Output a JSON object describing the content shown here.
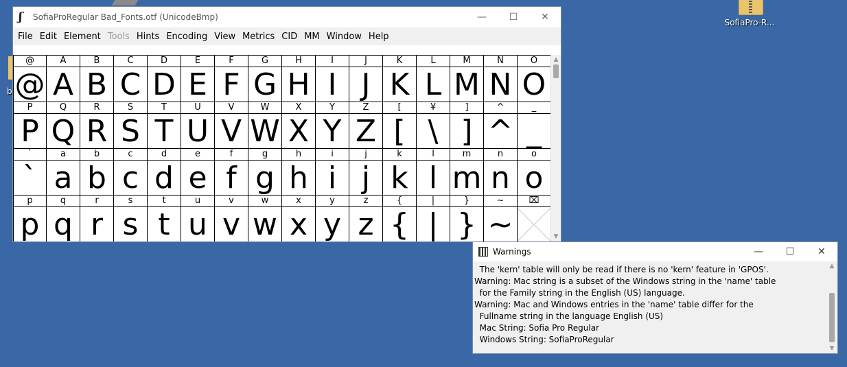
{
  "desktop": {
    "icon_label": "SofiaPro-R...",
    "left_peek_label": "b"
  },
  "main_window": {
    "title": "SofiaProRegular  Bad_Fonts.otf (UnicodeBmp)",
    "menu": [
      "File",
      "Edit",
      "Element",
      "Tools",
      "Hints",
      "Encoding",
      "View",
      "Metrics",
      "CID",
      "MM",
      "Window",
      "Help"
    ],
    "disabled_menu": [
      "Tools"
    ],
    "glyph_rows": [
      [
        {
          "l": "@",
          "g": "@"
        },
        {
          "l": "A",
          "g": "A"
        },
        {
          "l": "B",
          "g": "B"
        },
        {
          "l": "C",
          "g": "C"
        },
        {
          "l": "D",
          "g": "D"
        },
        {
          "l": "E",
          "g": "E"
        },
        {
          "l": "F",
          "g": "F"
        },
        {
          "l": "G",
          "g": "G"
        },
        {
          "l": "H",
          "g": "H"
        },
        {
          "l": "I",
          "g": "I"
        },
        {
          "l": "J",
          "g": "J"
        },
        {
          "l": "K",
          "g": "K"
        },
        {
          "l": "L",
          "g": "L"
        },
        {
          "l": "M",
          "g": "M"
        },
        {
          "l": "N",
          "g": "N"
        },
        {
          "l": "O",
          "g": "O"
        }
      ],
      [
        {
          "l": "P",
          "g": "P"
        },
        {
          "l": "Q",
          "g": "Q"
        },
        {
          "l": "R",
          "g": "R"
        },
        {
          "l": "S",
          "g": "S"
        },
        {
          "l": "T",
          "g": "T"
        },
        {
          "l": "U",
          "g": "U"
        },
        {
          "l": "V",
          "g": "V"
        },
        {
          "l": "W",
          "g": "W"
        },
        {
          "l": "X",
          "g": "X"
        },
        {
          "l": "Y",
          "g": "Y"
        },
        {
          "l": "Z",
          "g": "Z"
        },
        {
          "l": "[",
          "g": "["
        },
        {
          "l": "¥",
          "g": "\\"
        },
        {
          "l": "]",
          "g": "]"
        },
        {
          "l": "^",
          "g": "^"
        },
        {
          "l": "_",
          "g": "_"
        }
      ],
      [
        {
          "l": "`",
          "g": "`"
        },
        {
          "l": "a",
          "g": "a"
        },
        {
          "l": "b",
          "g": "b"
        },
        {
          "l": "c",
          "g": "c"
        },
        {
          "l": "d",
          "g": "d"
        },
        {
          "l": "e",
          "g": "e"
        },
        {
          "l": "f",
          "g": "f"
        },
        {
          "l": "g",
          "g": "g"
        },
        {
          "l": "h",
          "g": "h"
        },
        {
          "l": "i",
          "g": "i"
        },
        {
          "l": "j",
          "g": "j"
        },
        {
          "l": "k",
          "g": "k"
        },
        {
          "l": "l",
          "g": "l"
        },
        {
          "l": "m",
          "g": "m"
        },
        {
          "l": "n",
          "g": "n"
        },
        {
          "l": "o",
          "g": "o"
        }
      ],
      [
        {
          "l": "p",
          "g": "p"
        },
        {
          "l": "q",
          "g": "q"
        },
        {
          "l": "r",
          "g": "r"
        },
        {
          "l": "s",
          "g": "s"
        },
        {
          "l": "t",
          "g": "t"
        },
        {
          "l": "u",
          "g": "u"
        },
        {
          "l": "v",
          "g": "v"
        },
        {
          "l": "w",
          "g": "w"
        },
        {
          "l": "x",
          "g": "x"
        },
        {
          "l": "y",
          "g": "y"
        },
        {
          "l": "z",
          "g": "z"
        },
        {
          "l": "{",
          "g": "{"
        },
        {
          "l": "|",
          "g": "|"
        },
        {
          "l": "}",
          "g": "}"
        },
        {
          "l": "~",
          "g": "~"
        },
        {
          "l": "⌧",
          "g": ""
        }
      ]
    ]
  },
  "warnings_window": {
    "title": "Warnings",
    "lines": [
      "  The 'kern' table will only be read if there is no 'kern' feature in 'GPOS'.",
      "Warning: Mac string is a subset of the Windows string in the 'name' table",
      "  for the Family string in the English (US) language.",
      "Warning: Mac and Windows entries in the 'name' table differ for the",
      "  Fullname string in the language English (US)",
      "  Mac String: Sofia Pro Regular",
      "  Windows String: SofiaProRegular"
    ]
  }
}
